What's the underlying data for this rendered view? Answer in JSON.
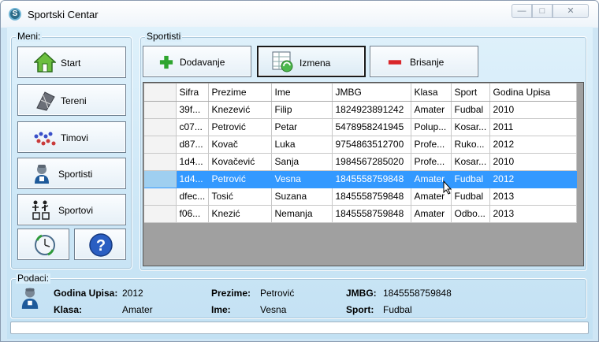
{
  "window": {
    "title": "Sportski Centar",
    "app_icon_glyph": "S",
    "controls": {
      "minimize": "—",
      "maximize": "□",
      "close": "✕"
    }
  },
  "menu": {
    "title": "Meni:",
    "items": [
      {
        "label": "Start",
        "icon": "house-icon"
      },
      {
        "label": "Tereni",
        "icon": "court-icon"
      },
      {
        "label": "Timovi",
        "icon": "team-icon"
      },
      {
        "label": "Sportisti",
        "icon": "athlete-icon"
      },
      {
        "label": "Sportovi",
        "icon": "sports-icon"
      }
    ],
    "small_buttons": [
      {
        "icon": "clock-refresh-icon"
      },
      {
        "icon": "help-icon",
        "glyph": "?"
      }
    ]
  },
  "sportisti": {
    "title": "Sportisti",
    "toolbar": {
      "add_label": "Dodavanje",
      "edit_label": "Izmena",
      "delete_label": "Brisanje"
    },
    "columns": [
      "Sifra",
      "Prezime",
      "Ime",
      "JMBG",
      "Klasa",
      "Sport",
      "Godina Upisa"
    ],
    "rows": [
      [
        "39f...",
        "Knezević",
        "Filip",
        "1824923891242",
        "Amater",
        "Fudbal",
        "2010"
      ],
      [
        "c07...",
        "Petrović",
        "Petar",
        "5478958241945",
        "Polup...",
        "Kosar...",
        "2011"
      ],
      [
        "d87...",
        "Kovač",
        "Luka",
        "9754863512700",
        "Profe...",
        "Ruko...",
        "2012"
      ],
      [
        "1d4...",
        "Kovačević",
        "Sanja",
        "1984567285020",
        "Profe...",
        "Kosar...",
        "2010"
      ],
      [
        "1d4...",
        "Petrović",
        "Vesna",
        "1845558759848",
        "Amater",
        "Fudbal",
        "2012"
      ],
      [
        "dfec...",
        "Tosić",
        "Suzana",
        "1845558759848",
        "Amater",
        "Fudbal",
        "2013"
      ],
      [
        "f06...",
        "Knezić",
        "Nemanja",
        "1845558759848",
        "Amater",
        "Odbo...",
        "2013"
      ]
    ],
    "selected_row": 4
  },
  "details": {
    "title": "Podaci:",
    "godina_label": "Godina Upisa:",
    "godina_value": "2012",
    "klasa_label": "Klasa:",
    "klasa_value": "Amater",
    "prezime_label": "Prezime:",
    "prezime_value": "Petrović",
    "ime_label": "Ime:",
    "ime_value": "Vesna",
    "jmbg_label": "JMBG:",
    "jmbg_value": "1845558759848",
    "sport_label": "Sport:",
    "sport_value": "Fudbal"
  },
  "colors": {
    "selection": "#3399ff",
    "client_bg": "#cfe8f7",
    "add_green": "#2ea52e",
    "delete_red": "#d9262a"
  }
}
